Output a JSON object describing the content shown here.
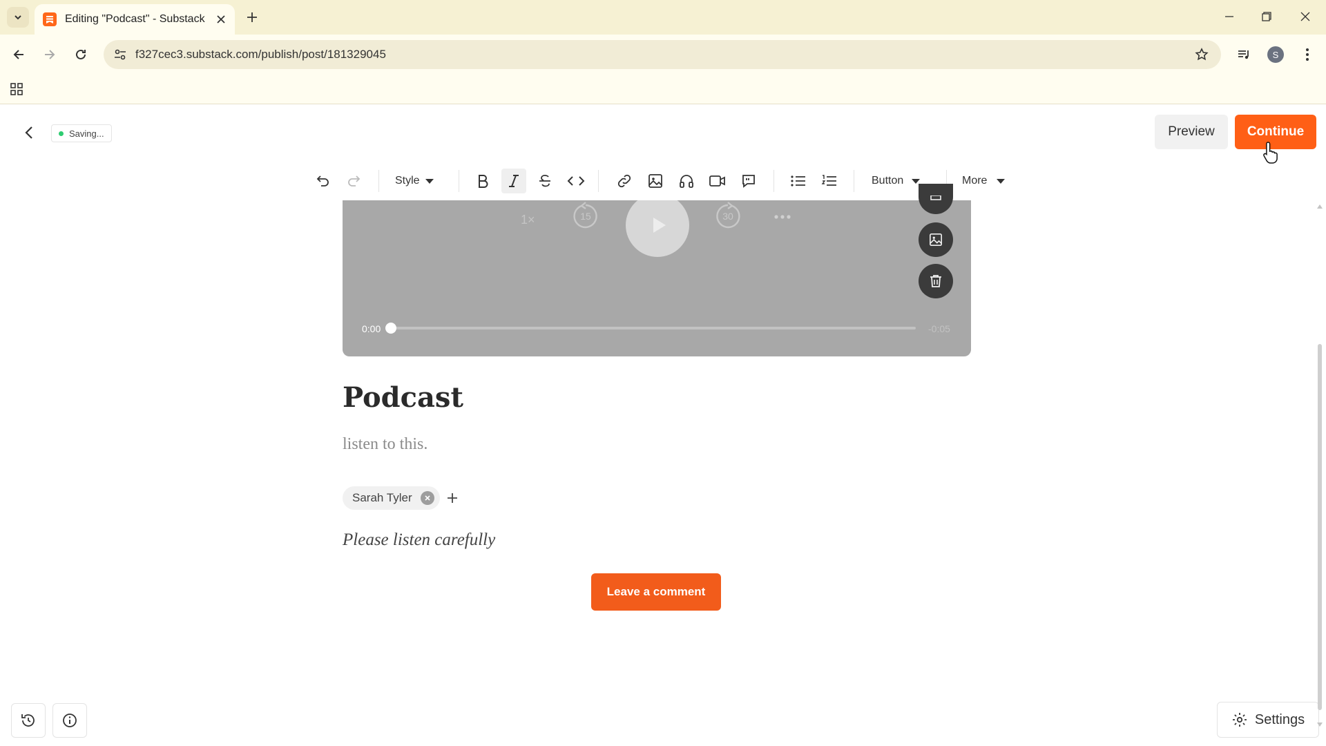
{
  "browser": {
    "tab_title": "Editing \"Podcast\" - Substack",
    "url": "f327cec3.substack.com/publish/post/181329045",
    "profile_initial": "S"
  },
  "editor": {
    "status": "Saving...",
    "preview_label": "Preview",
    "continue_label": "Continue",
    "toolbar": {
      "style_label": "Style",
      "button_label": "Button",
      "more_label": "More"
    },
    "player": {
      "speed": "1×",
      "rewind_seconds": "15",
      "forward_seconds": "30",
      "current_time": "0:00",
      "duration": "-0:05",
      "progress": 0
    },
    "post": {
      "title": "Podcast",
      "subtitle": "listen to this.",
      "author": "Sarah Tyler",
      "body": "Please listen carefully",
      "cta_label": "Leave a comment"
    },
    "settings_label": "Settings"
  },
  "colors": {
    "accent": "#ff5f16",
    "cta": "#f25c1b",
    "browser_frame": "#f6f1d3"
  }
}
